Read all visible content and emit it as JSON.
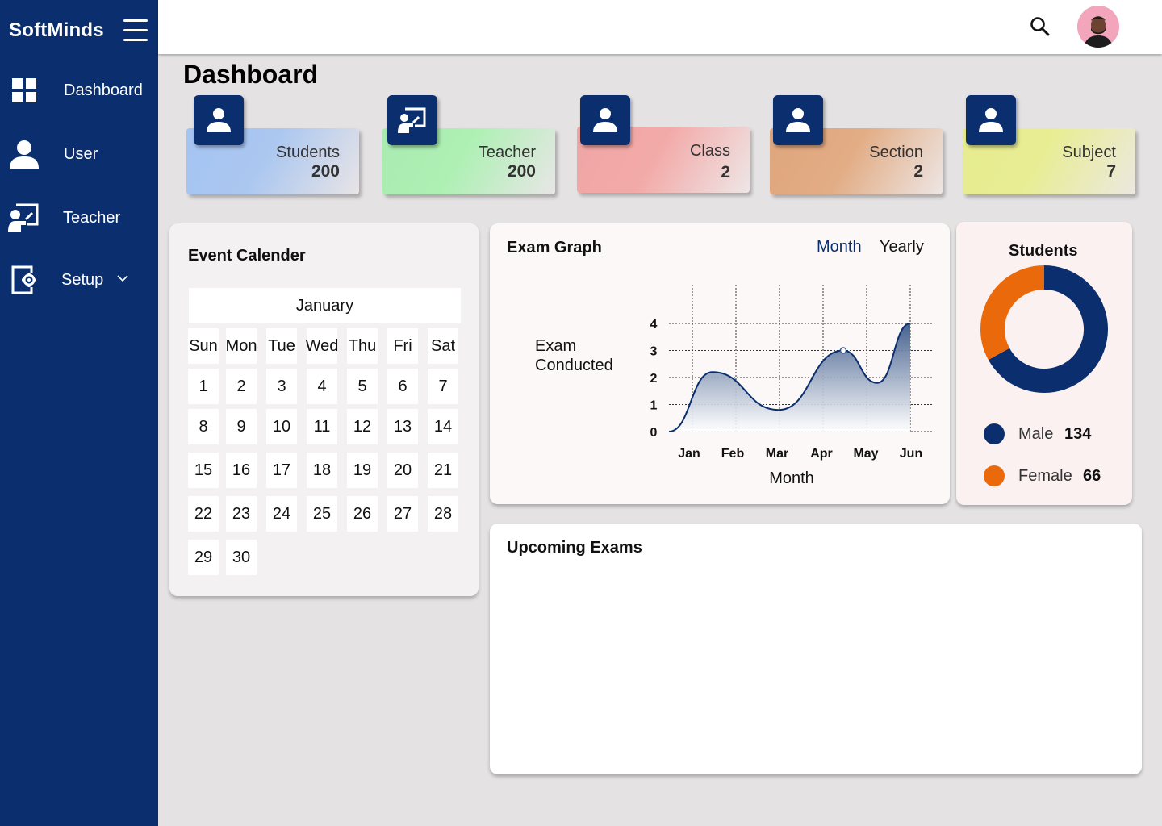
{
  "app": {
    "brand": "SoftMinds"
  },
  "sidebar": {
    "items": [
      {
        "label": "Dashboard",
        "icon": "grid-icon"
      },
      {
        "label": "User",
        "icon": "user-icon"
      },
      {
        "label": "Teacher",
        "icon": "teacher-icon"
      },
      {
        "label": "Setup",
        "icon": "setup-icon"
      }
    ]
  },
  "header": {
    "title": "Dashboard"
  },
  "stats": [
    {
      "label": "Students",
      "value": "200"
    },
    {
      "label": "Teacher",
      "value": "200"
    },
    {
      "label": "Class",
      "value": "2"
    },
    {
      "label": "Section",
      "value": "2"
    },
    {
      "label": "Subject",
      "value": "7"
    }
  ],
  "calendar": {
    "title": "Event Calender",
    "month": "January",
    "weekdays": [
      "Sun",
      "Mon",
      "Tue",
      "Wed",
      "Thu",
      "Fri",
      "Sat"
    ],
    "days": [
      "1",
      "2",
      "3",
      "4",
      "5",
      "6",
      "7",
      "8",
      "9",
      "10",
      "11",
      "12",
      "13",
      "14",
      "15",
      "16",
      "17",
      "18",
      "19",
      "20",
      "21",
      "22",
      "23",
      "24",
      "25",
      "26",
      "27",
      "28",
      "29",
      "30"
    ]
  },
  "exam_graph": {
    "title": "Exam Graph",
    "tabs": [
      "Month",
      "Yearly"
    ],
    "active_tab": "Month"
  },
  "students_panel": {
    "title": "Students",
    "legend": [
      {
        "label": "Male",
        "value": "134",
        "color": "#0b2f6e"
      },
      {
        "label": "Female",
        "value": "66",
        "color": "#ea6a0b"
      }
    ]
  },
  "upcoming": {
    "title": "Upcoming Exams"
  },
  "chart_data": [
    {
      "type": "area",
      "title": "",
      "xlabel": "Month",
      "ylabel": "Exam Conducted",
      "categories": [
        "Jan",
        "Feb",
        "Mar",
        "Apr",
        "May",
        "Jun"
      ],
      "values": [
        2,
        1.2,
        0.8,
        3,
        2.1,
        4
      ],
      "ylim": [
        0,
        4
      ],
      "yticks": [
        "0",
        "1",
        "2",
        "3",
        "4"
      ],
      "grid": true
    },
    {
      "type": "pie",
      "title": "Students",
      "categories": [
        "Male",
        "Female"
      ],
      "values": [
        134,
        66
      ],
      "colors": [
        "#0b2f6e",
        "#ea6a0b"
      ]
    }
  ]
}
